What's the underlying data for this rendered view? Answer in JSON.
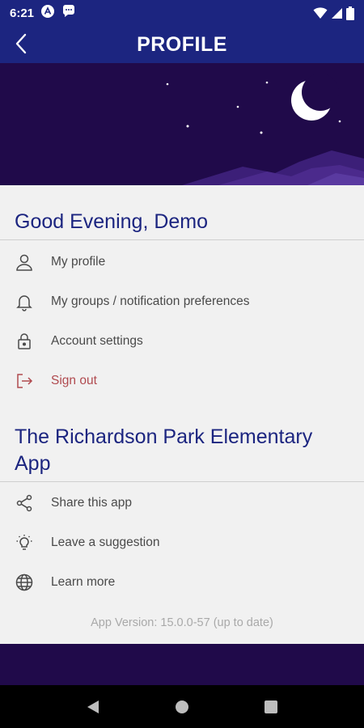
{
  "status_bar": {
    "time": "6:21"
  },
  "app_bar": {
    "title": "PROFILE"
  },
  "greeting": "Good Evening, Demo",
  "account_menu": [
    {
      "label": "My profile",
      "icon": "person-icon"
    },
    {
      "label": "My groups / notification preferences",
      "icon": "bell-icon"
    },
    {
      "label": "Account settings",
      "icon": "lock-icon"
    },
    {
      "label": "Sign out",
      "icon": "sign-out-icon"
    }
  ],
  "app_section_title": "The Richardson Park Elementary App",
  "app_menu": [
    {
      "label": "Share this app",
      "icon": "share-icon"
    },
    {
      "label": "Leave a suggestion",
      "icon": "lightbulb-icon"
    },
    {
      "label": "Learn more",
      "icon": "globe-icon"
    }
  ],
  "version_text": "App Version: 15.0.0-57 (up to date)",
  "colors": {
    "primary": "#1c2580",
    "hero_bg": "#200a4a",
    "sign_out": "#b04a4f",
    "content_bg": "#f1f1f1"
  }
}
